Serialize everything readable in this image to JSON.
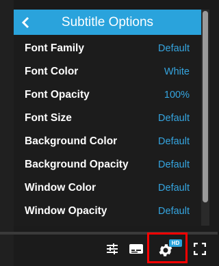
{
  "panel": {
    "title": "Subtitle Options",
    "options": [
      {
        "label": "Font Family",
        "value": "Default"
      },
      {
        "label": "Font Color",
        "value": "White"
      },
      {
        "label": "Font Opacity",
        "value": "100%"
      },
      {
        "label": "Font Size",
        "value": "Default"
      },
      {
        "label": "Background Color",
        "value": "Default"
      },
      {
        "label": "Background Opacity",
        "value": "Default"
      },
      {
        "label": "Window Color",
        "value": "Default"
      },
      {
        "label": "Window Opacity",
        "value": "Default"
      }
    ]
  },
  "controls": {
    "settings_badge": "HD",
    "icons": [
      "sliders-icon",
      "subtitles-icon",
      "gear-icon",
      "fullscreen-icon"
    ]
  },
  "colors": {
    "accent": "#2aa3dc",
    "value_text": "#35a5e0",
    "highlight": "#ff0000"
  }
}
